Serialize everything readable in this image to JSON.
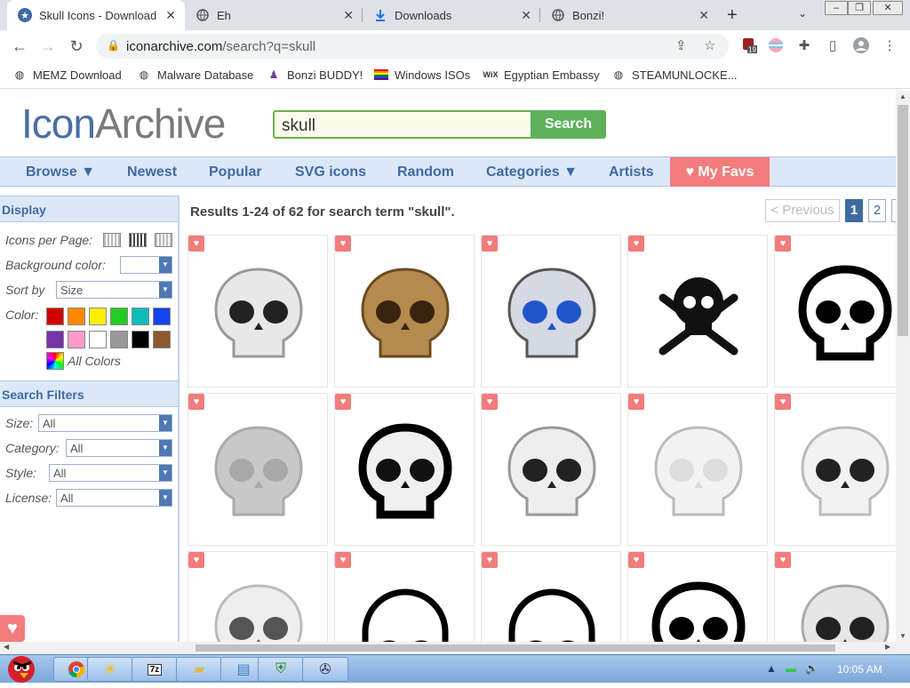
{
  "tabs": [
    {
      "title": "Skull Icons - Download",
      "icon": "star-icon"
    },
    {
      "title": "Eh",
      "icon": "globe-icon"
    },
    {
      "title": "Downloads",
      "icon": "download-icon"
    },
    {
      "title": "Bonzi!",
      "icon": "globe-icon"
    }
  ],
  "url": {
    "host": "iconarchive.com",
    "path": "/search?q=skull"
  },
  "ext_badge": "19",
  "bookmarks": [
    {
      "label": "MEMZ Download"
    },
    {
      "label": "Malware Database"
    },
    {
      "label": "Bonzi BUDDY!"
    },
    {
      "label": "Windows ISOs"
    },
    {
      "label": "Egyptian Embassy"
    },
    {
      "label": "STEAMUNLOCKE..."
    }
  ],
  "site": {
    "logo_a": "Icon",
    "logo_b": "Archive",
    "search_value": "skull",
    "search_label": "Search"
  },
  "nav": [
    "Browse ▼",
    "Newest",
    "Popular",
    "SVG icons",
    "Random",
    "Categories ▼",
    "Artists"
  ],
  "favs": "♥ My Favs",
  "sidebar": {
    "display_title": "Display",
    "icons_per_page": "Icons per Page:",
    "bg_color": "Background color:",
    "sort_by": "Sort by",
    "sort_value": "Size",
    "color": "Color:",
    "all_colors": "All Colors",
    "filters_title": "Search Filters",
    "size": "Size:",
    "category": "Category:",
    "style": "Style:",
    "license": "License:",
    "all": "All",
    "swatches": [
      "#d10000",
      "#ff8800",
      "#ffee00",
      "#22cc22",
      "#11bbbb",
      "#1144ee",
      "#7733aa",
      "#ff99cc",
      "#ffffff",
      "#999999",
      "#000000",
      "#8a5a2a"
    ]
  },
  "results": "Results 1-24 of 62 for search term \"skull\".",
  "pager": {
    "prev": "< Previous",
    "p1": "1",
    "p2": "2"
  },
  "taskbar": {
    "clock": "10:05 AM"
  }
}
